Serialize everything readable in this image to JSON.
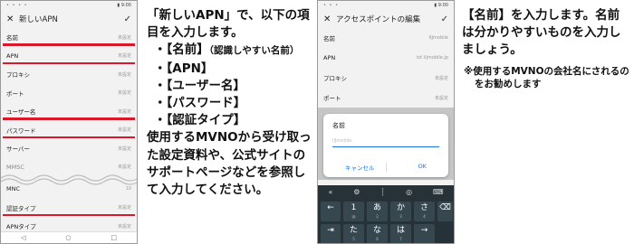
{
  "phone1": {
    "title": "新しいAPN",
    "rows": [
      {
        "label": "名前",
        "value": "未設定"
      },
      {
        "label": "APN",
        "value": "未設定"
      },
      {
        "label": "プロキシ",
        "value": "未設定"
      },
      {
        "label": "ポート",
        "value": "未設定"
      },
      {
        "label": "ユーザー名",
        "value": "未設定"
      },
      {
        "label": "パスワード",
        "value": "未設定"
      },
      {
        "label": "サーバー",
        "value": "未設定"
      },
      {
        "label": "MMSC",
        "value": "未設定"
      },
      {
        "label": "MNC",
        "value": "10"
      },
      {
        "label": "認証タイプ",
        "value": "未設定"
      },
      {
        "label": "APNタイプ",
        "value": "未設定"
      }
    ]
  },
  "text1": {
    "intro": "「新しいAPN」で、以下の項目を入力します。",
    "items": [
      "・【名前】",
      "（認識しやすい名前）",
      "・【APN】",
      "・【ユーザー名】",
      "・【パスワード】",
      "・【認証タイプ】"
    ],
    "body": "使用するMVNOから受け取った設定資料や、公式サイトのサポートページなどを参照して入力してください。"
  },
  "phone2": {
    "title": "アクセスポイントの編集",
    "rows": [
      {
        "label": "名前",
        "value": "IIJmobile"
      },
      {
        "label": "APN",
        "value": "iot.iijmobile.jp"
      },
      {
        "label": "プロキシ",
        "value": "未設定"
      },
      {
        "label": "ポート",
        "value": "未設定"
      }
    ],
    "dialog": {
      "title": "名前",
      "input": "IIJmobile",
      "cancel": "キャンセル",
      "ok": "OK"
    },
    "keys": [
      {
        "main": "←",
        "sub": ""
      },
      {
        "main": "1",
        "sub": "@"
      },
      {
        "main": "あ",
        "sub": "2"
      },
      {
        "main": "か",
        "sub": "3"
      },
      {
        "main": "さ",
        "sub": "4"
      },
      {
        "main": "⌫",
        "sub": ""
      },
      {
        "main": "⇥",
        "sub": ""
      },
      {
        "main": "た",
        "sub": "5"
      },
      {
        "main": "な",
        "sub": "6"
      },
      {
        "main": "は",
        "sub": "7"
      },
      {
        "main": "→",
        "sub": ""
      }
    ]
  },
  "text2": {
    "main": "【名前】を入力します。名前は分かりやすいものを入力しましょう。",
    "note": "※使用するMVNOの会社名にされるのをお勧めします"
  },
  "colors": {
    "highlight": "#d9192a",
    "accent": "#1a73e8",
    "keyboard": "#263238"
  }
}
